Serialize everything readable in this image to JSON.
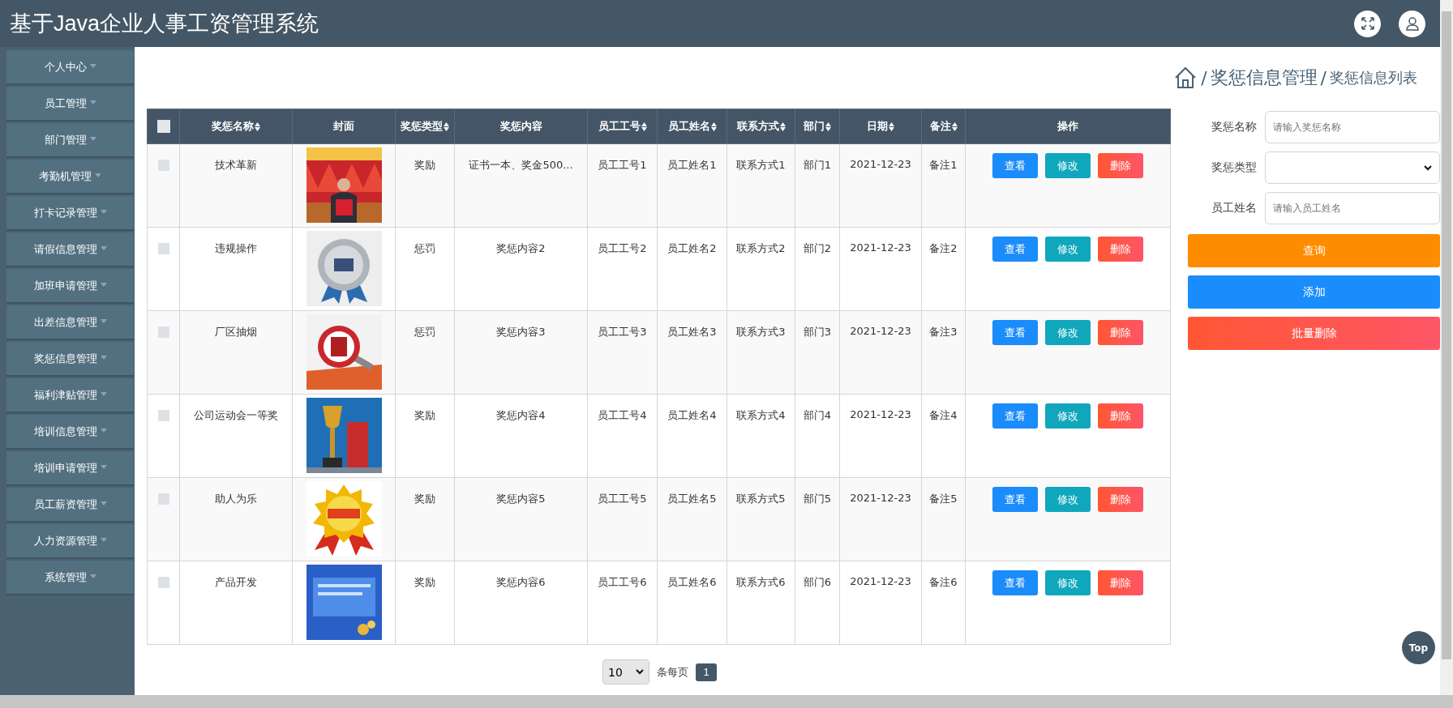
{
  "header": {
    "title": "基于Java企业人事工资管理系统"
  },
  "sidebar": {
    "items": [
      {
        "label": "个人中心"
      },
      {
        "label": "员工管理"
      },
      {
        "label": "部门管理"
      },
      {
        "label": "考勤机管理"
      },
      {
        "label": "打卡记录管理"
      },
      {
        "label": "请假信息管理"
      },
      {
        "label": "加班申请管理"
      },
      {
        "label": "出差信息管理"
      },
      {
        "label": "奖惩信息管理"
      },
      {
        "label": "福利津贴管理"
      },
      {
        "label": "培训信息管理"
      },
      {
        "label": "培训申请管理"
      },
      {
        "label": "员工薪资管理"
      },
      {
        "label": "人力资源管理"
      },
      {
        "label": "系统管理"
      }
    ]
  },
  "breadcrumb": {
    "items": [
      {
        "kind": "separator",
        "label": "/"
      },
      {
        "kind": "link",
        "label": "奖惩信息管理"
      },
      {
        "kind": "separator",
        "label": "/"
      },
      {
        "kind": "current",
        "label": "奖惩信息列表"
      }
    ]
  },
  "table": {
    "header_checked": false,
    "columns": [
      {
        "label": "奖惩名称",
        "sortable": true
      },
      {
        "label": "封面",
        "sortable": false
      },
      {
        "label": "奖惩类型",
        "sortable": true
      },
      {
        "label": "奖惩内容",
        "sortable": false
      },
      {
        "label": "员工工号",
        "sortable": true
      },
      {
        "label": "员工姓名",
        "sortable": true
      },
      {
        "label": "联系方式",
        "sortable": true
      },
      {
        "label": "部门",
        "sortable": true
      },
      {
        "label": "日期",
        "sortable": true
      },
      {
        "label": "备注",
        "sortable": true
      },
      {
        "label": "操作",
        "sortable": false
      }
    ],
    "rows": [
      {
        "checked": false,
        "name": "技术革新",
        "cover": {
          "kind": "picture"
        },
        "type": "奖励",
        "content": "证书一本、奖金500...",
        "employee_no": "员工工号1",
        "employee_name": "员工姓名1",
        "contact": "联系方式1",
        "department": "部门1",
        "date": "2021-12-23",
        "note": "备注1",
        "actions": [
          {
            "label": "查看",
            "kind": "view"
          },
          {
            "label": "修改",
            "kind": "edit"
          },
          {
            "label": "删除",
            "kind": "delete"
          }
        ]
      },
      {
        "checked": false,
        "name": "违规操作",
        "cover": {
          "kind": "picture"
        },
        "type": "惩罚",
        "content": "奖惩内容2",
        "employee_no": "员工工号2",
        "employee_name": "员工姓名2",
        "contact": "联系方式2",
        "department": "部门2",
        "date": "2021-12-23",
        "note": "备注2",
        "actions": [
          {
            "label": "查看",
            "kind": "view"
          },
          {
            "label": "修改",
            "kind": "edit"
          },
          {
            "label": "删除",
            "kind": "delete"
          }
        ]
      },
      {
        "checked": false,
        "name": "厂区抽烟",
        "cover": {
          "kind": "picture"
        },
        "type": "惩罚",
        "content": "奖惩内容3",
        "employee_no": "员工工号3",
        "employee_name": "员工姓名3",
        "contact": "联系方式3",
        "department": "部门3",
        "date": "2021-12-23",
        "note": "备注3",
        "actions": [
          {
            "label": "查看",
            "kind": "view"
          },
          {
            "label": "修改",
            "kind": "edit"
          },
          {
            "label": "删除",
            "kind": "delete"
          }
        ]
      },
      {
        "checked": false,
        "name": "公司运动会一等奖",
        "cover": {
          "kind": "picture"
        },
        "type": "奖励",
        "content": "奖惩内容4",
        "employee_no": "员工工号4",
        "employee_name": "员工姓名4",
        "contact": "联系方式4",
        "department": "部门4",
        "date": "2021-12-23",
        "note": "备注4",
        "actions": [
          {
            "label": "查看",
            "kind": "view"
          },
          {
            "label": "修改",
            "kind": "edit"
          },
          {
            "label": "删除",
            "kind": "delete"
          }
        ]
      },
      {
        "checked": false,
        "name": "助人为乐",
        "cover": {
          "kind": "picture"
        },
        "type": "奖励",
        "content": "奖惩内容5",
        "employee_no": "员工工号5",
        "employee_name": "员工姓名5",
        "contact": "联系方式5",
        "department": "部门5",
        "date": "2021-12-23",
        "note": "备注5",
        "actions": [
          {
            "label": "查看",
            "kind": "view"
          },
          {
            "label": "修改",
            "kind": "edit"
          },
          {
            "label": "删除",
            "kind": "delete"
          }
        ]
      },
      {
        "checked": false,
        "name": "产品开发",
        "cover": {
          "kind": "picture"
        },
        "type": "奖励",
        "content": "奖惩内容6",
        "employee_no": "员工工号6",
        "employee_name": "员工姓名6",
        "contact": "联系方式6",
        "department": "部门6",
        "date": "2021-12-23",
        "note": "备注6",
        "actions": [
          {
            "label": "查看",
            "kind": "view"
          },
          {
            "label": "修改",
            "kind": "edit"
          },
          {
            "label": "删除",
            "kind": "delete"
          }
        ]
      }
    ]
  },
  "search": {
    "fields": [
      {
        "label": "奖惩名称",
        "kind": "text",
        "placeholder": "请输入奖惩名称"
      },
      {
        "label": "奖惩类型",
        "kind": "select"
      },
      {
        "label": "员工姓名",
        "kind": "text",
        "placeholder": "请输入员工姓名"
      }
    ],
    "buttons": [
      {
        "label": "查询",
        "kind": "query"
      },
      {
        "label": "添加",
        "kind": "add"
      },
      {
        "label": "批量删除",
        "kind": "batch_delete"
      }
    ]
  },
  "pagination": {
    "page_size": "10",
    "per_page_label": "条每页",
    "pages": [
      {
        "label": "1",
        "selected": true
      }
    ]
  },
  "top_button": {
    "label": "Top"
  }
}
